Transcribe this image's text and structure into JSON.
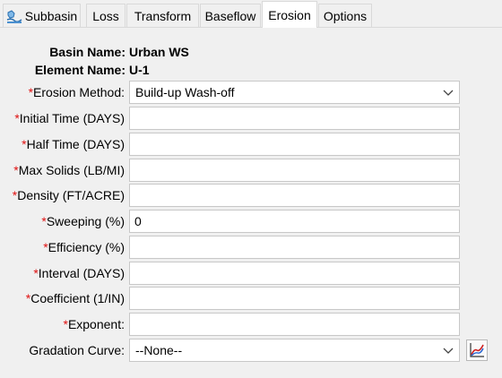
{
  "tabs": [
    {
      "label": "Subbasin",
      "icon": "subbasin-icon"
    },
    {
      "label": "Loss"
    },
    {
      "label": "Transform"
    },
    {
      "label": "Baseflow"
    },
    {
      "label": "Erosion",
      "active": true
    },
    {
      "label": "Options"
    }
  ],
  "info": {
    "basin_label": "Basin Name:",
    "basin_value": "Urban WS",
    "element_label": "Element Name:",
    "element_value": "U-1"
  },
  "required_marker": "*",
  "form": {
    "erosion_method": {
      "label": "Erosion Method:",
      "value": "Build-up Wash-off"
    },
    "initial_time": {
      "label": "Initial Time (DAYS)",
      "value": ""
    },
    "half_time": {
      "label": "Half Time (DAYS)",
      "value": ""
    },
    "max_solids": {
      "label": "Max Solids (LB/MI)",
      "value": ""
    },
    "density": {
      "label": "Density (FT/ACRE)",
      "value": ""
    },
    "sweeping": {
      "label": "Sweeping (%)",
      "value": "0"
    },
    "efficiency": {
      "label": "Efficiency (%)",
      "value": ""
    },
    "interval": {
      "label": "Interval (DAYS)",
      "value": ""
    },
    "coefficient": {
      "label": "Coefficient (1/IN)",
      "value": ""
    },
    "exponent": {
      "label": "Exponent:",
      "value": ""
    },
    "gradation_curve": {
      "label": "Gradation Curve:",
      "value": "--None--"
    }
  },
  "colors": {
    "required": "#e01010",
    "active_tab": "#ffffff",
    "background": "#f0f0f0"
  }
}
